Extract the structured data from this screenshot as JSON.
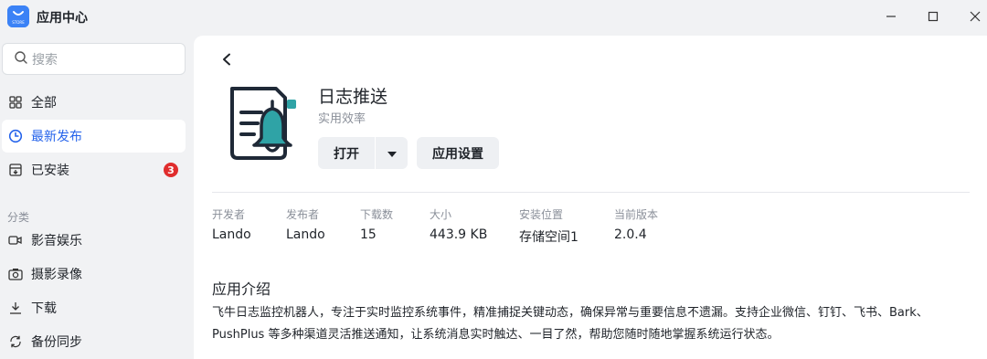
{
  "window": {
    "title": "应用中心",
    "logo_caption": "STORE"
  },
  "sidebar": {
    "search_placeholder": "搜索",
    "items": [
      {
        "label": "全部",
        "icon": "grid-icon"
      },
      {
        "label": "最新发布",
        "icon": "clock-icon",
        "active": true
      },
      {
        "label": "已安装",
        "icon": "installed-box-icon",
        "badge": "3"
      }
    ],
    "category_label": "分类",
    "categories": [
      {
        "label": "影音娱乐",
        "icon": "video-icon"
      },
      {
        "label": "摄影录像",
        "icon": "camera-icon"
      },
      {
        "label": "下载",
        "icon": "download-icon"
      },
      {
        "label": "备份同步",
        "icon": "sync-icon"
      }
    ]
  },
  "app": {
    "name": "日志推送",
    "category": "实用效率",
    "open_label": "打开",
    "settings_label": "应用设置",
    "meta": [
      {
        "key": "开发者",
        "value": "Lando"
      },
      {
        "key": "发布者",
        "value": "Lando"
      },
      {
        "key": "下载数",
        "value": "15"
      },
      {
        "key": "大小",
        "value": "443.9 KB"
      },
      {
        "key": "安装位置",
        "value": "存储空间1"
      },
      {
        "key": "当前版本",
        "value": "2.0.4"
      }
    ],
    "intro_title": "应用介绍",
    "intro_text": "飞牛日志监控机器人，专注于实时监控系统事件，精准捕捉关键动态，确保异常与重要信息不遗漏。支持企业微信、钉钉、飞书、Bark、PushPlus 等多种渠道灵活推送通知，让系统消息实时触达、一目了然，帮助您随时随地掌握系统运行状态。"
  },
  "colors": {
    "accent": "#2563eb",
    "badge": "#e02d2d",
    "bell_teal": "#2fa3a6"
  }
}
